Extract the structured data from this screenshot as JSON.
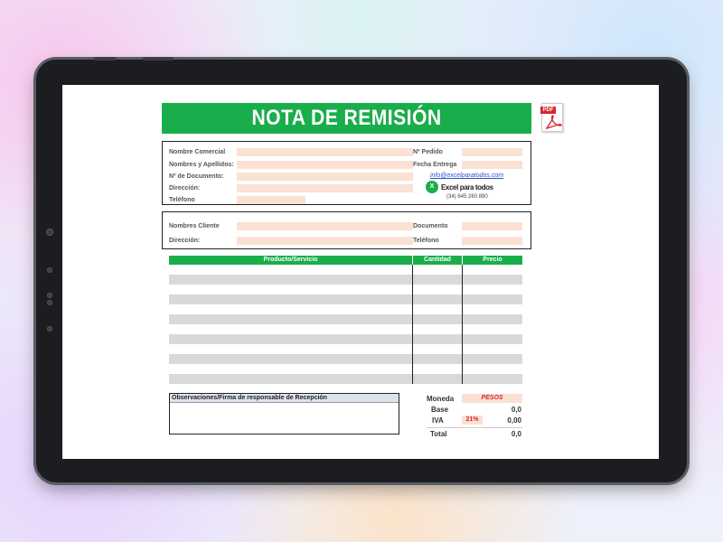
{
  "title": "NOTA DE REMISIÓN",
  "pdf_label": "PDF",
  "issuer": {
    "commercial_name": "Nombre Comercial",
    "full_name": "Nombres y Apellidos:",
    "document_number": "Nº de Documento:",
    "address": "Dirección:",
    "phone": "Teléfono",
    "order_number": "Nº Pedido",
    "delivery_date": "Fecha Entrega",
    "email": "info@excelparatodos.com",
    "logo_text": "Excel para todos",
    "contact_phone": "(34) 645 260 890"
  },
  "client": {
    "name": "Nombres Cliente",
    "address": "Dirección:",
    "document": "Documento",
    "phone": "Teléfono"
  },
  "table": {
    "columns": [
      "Producto/Servicio",
      "Cantidad",
      "Precio"
    ]
  },
  "observations_label": "Observaciones/Firma de responsable de Recepción",
  "summary": {
    "currency_label": "Moneda",
    "currency_value": "PESOS",
    "base_label": "Base",
    "base_value": "0,0",
    "iva_label": "IVA",
    "iva_rate": "21%",
    "iva_value": "0,00",
    "total_label": "Total",
    "total_value": "0,0"
  },
  "colors": {
    "accent_green": "#1aad4b",
    "field_fill": "#fbe1d3",
    "stripe_gray": "#d9d9d9",
    "alert_red": "#d7262c"
  },
  "icons": [
    "pdf-icon",
    "excel-logo-icon"
  ]
}
